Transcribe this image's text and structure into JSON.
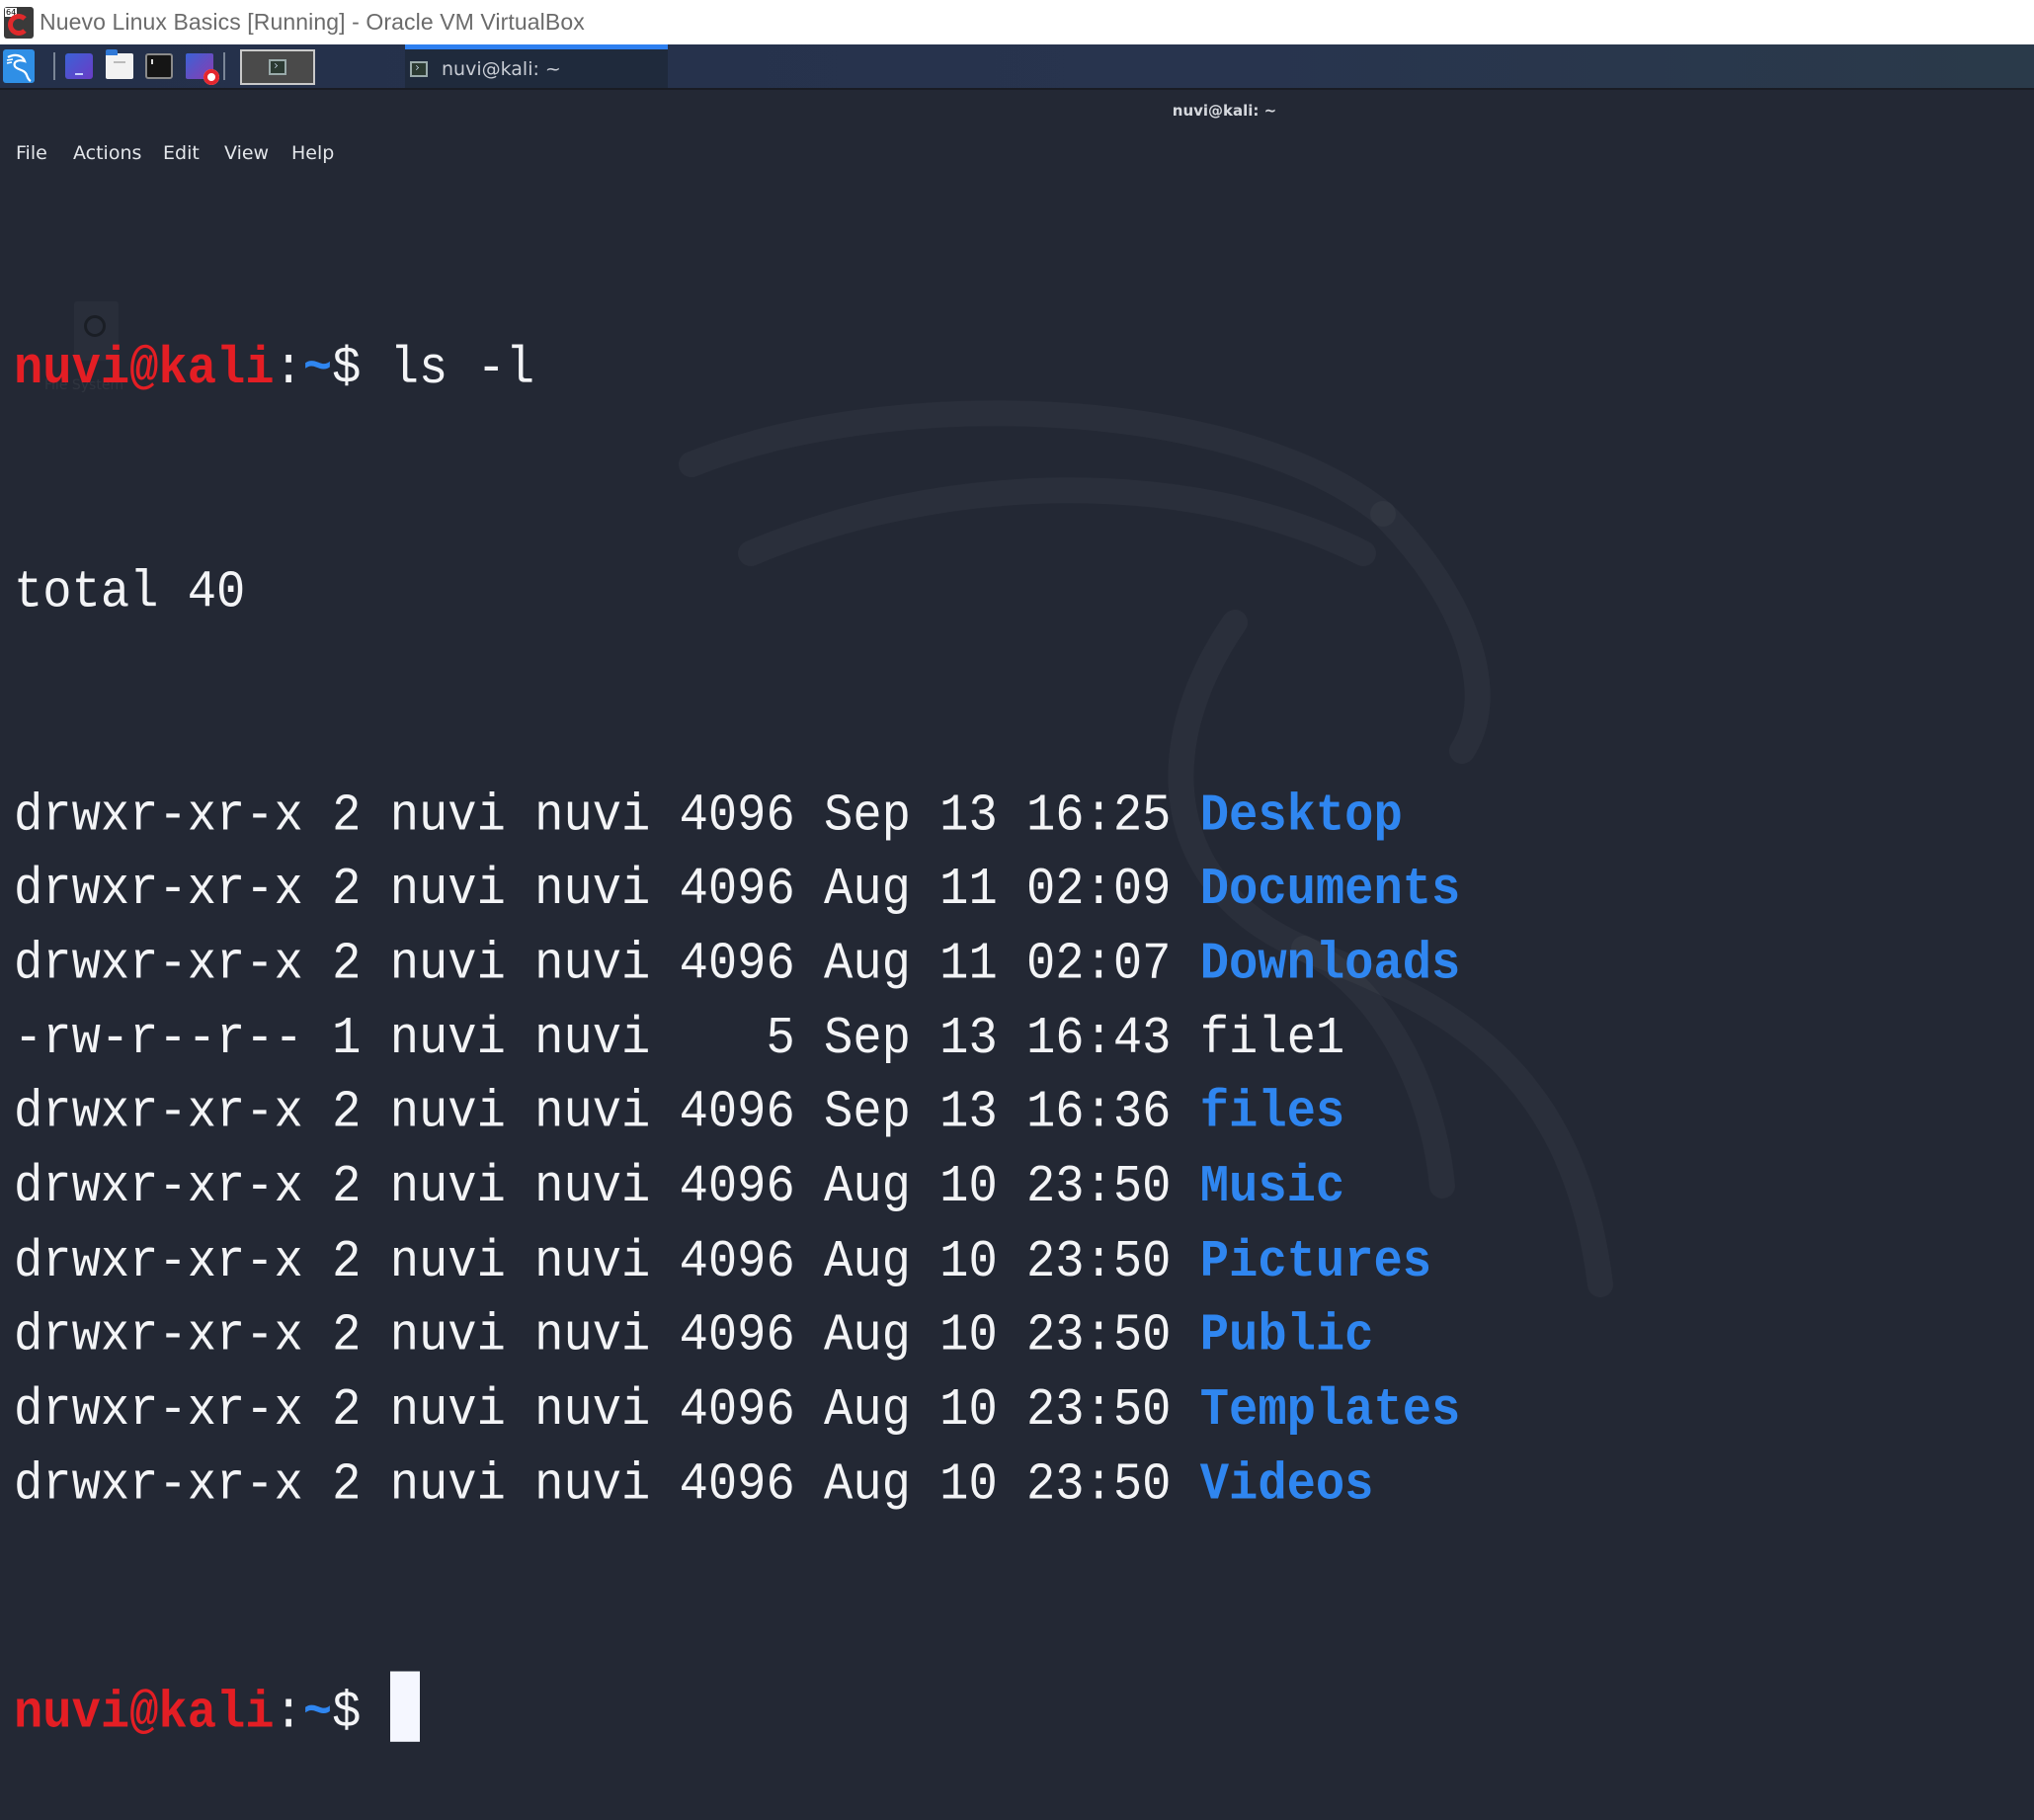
{
  "host_window": {
    "title": "Nuevo Linux Basics [Running] - Oracle VM VirtualBox",
    "logo_badge": "64"
  },
  "panel": {
    "launchers": [
      "kali-menu",
      "workspace",
      "file-manager",
      "terminal",
      "screen-recorder"
    ],
    "task_label": "nuvi@kali: ~"
  },
  "terminal": {
    "window_title": "nuvi@kali: ~",
    "menu": [
      "File",
      "Actions",
      "Edit",
      "View",
      "Help"
    ],
    "prompt": {
      "user_host": "nuvi@kali",
      "colon": ":",
      "path": "~",
      "symbol": "$"
    },
    "command": " ls -l",
    "total": "total 40",
    "rows": [
      {
        "perms": "drwxr-xr-x",
        "links": "2",
        "owner": "nuvi",
        "group": "nuvi",
        "size": "4096",
        "date": "Sep 13 16:25",
        "name": "Desktop",
        "type": "dir"
      },
      {
        "perms": "drwxr-xr-x",
        "links": "2",
        "owner": "nuvi",
        "group": "nuvi",
        "size": "4096",
        "date": "Aug 11 02:09",
        "name": "Documents",
        "type": "dir"
      },
      {
        "perms": "drwxr-xr-x",
        "links": "2",
        "owner": "nuvi",
        "group": "nuvi",
        "size": "4096",
        "date": "Aug 11 02:07",
        "name": "Downloads",
        "type": "dir"
      },
      {
        "perms": "-rw-r--r--",
        "links": "1",
        "owner": "nuvi",
        "group": "nuvi",
        "size": "   5",
        "date": "Sep 13 16:43",
        "name": "file1",
        "type": "file"
      },
      {
        "perms": "drwxr-xr-x",
        "links": "2",
        "owner": "nuvi",
        "group": "nuvi",
        "size": "4096",
        "date": "Sep 13 16:36",
        "name": "files",
        "type": "dir"
      },
      {
        "perms": "drwxr-xr-x",
        "links": "2",
        "owner": "nuvi",
        "group": "nuvi",
        "size": "4096",
        "date": "Aug 10 23:50",
        "name": "Music",
        "type": "dir"
      },
      {
        "perms": "drwxr-xr-x",
        "links": "2",
        "owner": "nuvi",
        "group": "nuvi",
        "size": "4096",
        "date": "Aug 10 23:50",
        "name": "Pictures",
        "type": "dir"
      },
      {
        "perms": "drwxr-xr-x",
        "links": "2",
        "owner": "nuvi",
        "group": "nuvi",
        "size": "4096",
        "date": "Aug 10 23:50",
        "name": "Public",
        "type": "dir"
      },
      {
        "perms": "drwxr-xr-x",
        "links": "2",
        "owner": "nuvi",
        "group": "nuvi",
        "size": "4096",
        "date": "Aug 10 23:50",
        "name": "Templates",
        "type": "dir"
      },
      {
        "perms": "drwxr-xr-x",
        "links": "2",
        "owner": "nuvi",
        "group": "nuvi",
        "size": "4096",
        "date": "Aug 10 23:50",
        "name": "Videos",
        "type": "dir"
      }
    ],
    "colors": {
      "user": "#e41e24",
      "path": "#2f86f0",
      "directory": "#2f86f0",
      "text": "#f3f4f6",
      "background": "#232834"
    }
  },
  "desktop": {
    "ghost_icon_label": "File System"
  }
}
